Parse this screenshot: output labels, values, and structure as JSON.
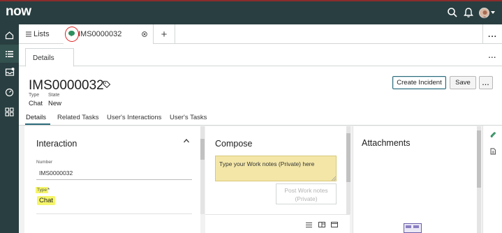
{
  "brand": {
    "logo_text": "now"
  },
  "colors": {
    "topbar": "#293e40",
    "accent": "#2b6a7a",
    "worknotes_bg": "#f3e6a7",
    "highlight": "#f5f56a"
  },
  "header": {
    "icons": [
      "search-icon",
      "bell-icon",
      "user-avatar"
    ]
  },
  "leftnav": {
    "items": [
      "home-icon",
      "list-icon",
      "inbox-icon",
      "dashboard-icon",
      "grid-icon"
    ]
  },
  "tabs": {
    "lists_label": "Lists",
    "record_label": "IMS0000032",
    "add_label": "+",
    "more_label": "..."
  },
  "subtabs": {
    "details_label": "Details",
    "more_label": "..."
  },
  "record": {
    "number": "IMS0000032",
    "type_label": "Type",
    "type_value": "Chat",
    "state_label": "State",
    "state_value": "New"
  },
  "actions": {
    "create_incident": "Create Incident",
    "save": "Save",
    "more": "..."
  },
  "form_tabs": [
    "Details",
    "Related Tasks",
    "User's Interactions",
    "User's Tasks"
  ],
  "interaction": {
    "title": "Interaction",
    "number_label": "Number",
    "number_value": "IMS0000032",
    "type_label": "Type",
    "type_required": "*",
    "type_value": "Chat"
  },
  "compose": {
    "title": "Compose",
    "worknotes_placeholder": "Type your Work notes (Private) here",
    "post_line1": "Post Work notes",
    "post_line2": "(Private)"
  },
  "attachments": {
    "title": "Attachments"
  }
}
